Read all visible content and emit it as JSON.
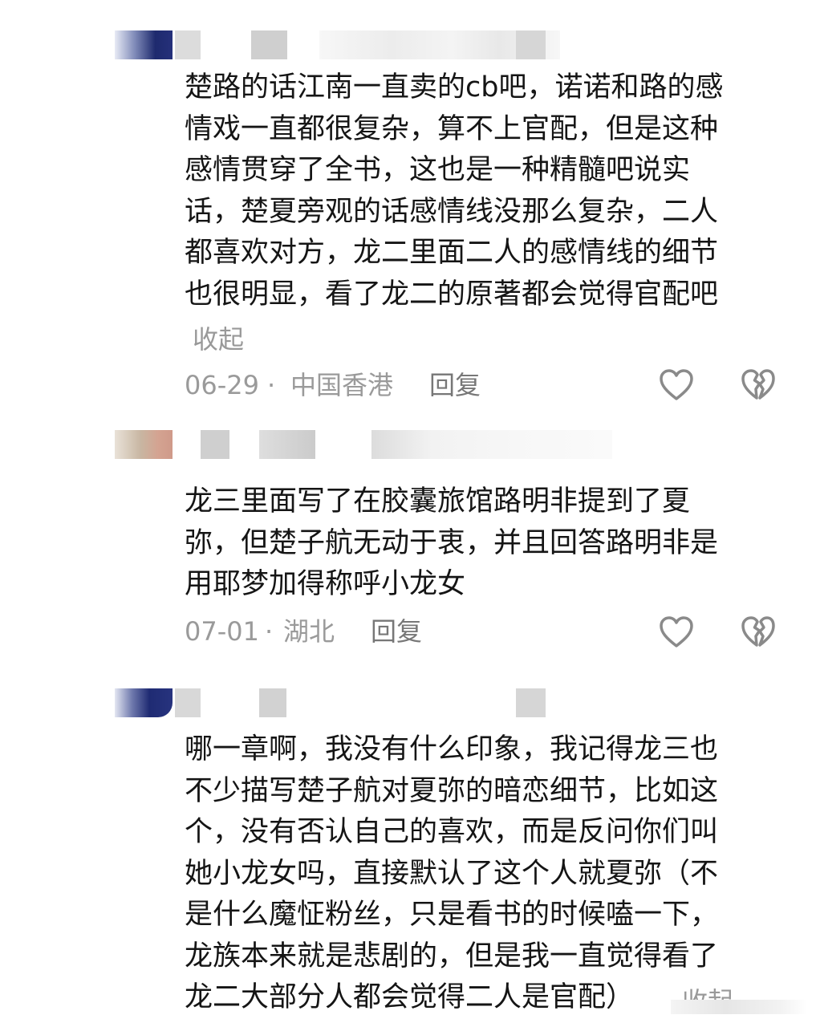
{
  "comments": [
    {
      "username": "",
      "text": "楚路的话江南一直卖的cb吧，诺诺和路的感\n情戏一直都很复杂，算不上官配，但是这种\n感情贯穿了全书，这也是一种精髓吧说实\n话，楚夏旁观的话感情线没那么复杂，二人\n都喜欢对方，龙二里面二人的感情线的细节\n也很明显，看了龙二的原著都会觉得官配吧",
      "collapse": "收起",
      "date": "06-29",
      "separator": "·",
      "location": "中国香港",
      "reply": "回复"
    },
    {
      "username": "",
      "text": "龙三里面写了在胶囊旅馆路明非提到了夏\n弥，但楚子航无动于衷，并且回答路明非是\n用耶梦加得称呼小龙女",
      "date": "07-01",
      "separator": "·",
      "location": "湖北",
      "reply": "回复"
    },
    {
      "username": "",
      "text": "哪一章啊，我没有什么印象，我记得龙三也\n不少描写楚子航对夏弥的暗恋细节，比如这\n个，没有否认自己的喜欢，而是反问你们叫\n她小龙女吗，直接默认了这个人就夏弥（不\n是什么魔怔粉丝，只是看书的时候嗑一下，\n龙族本来就是悲剧的，但是我一直觉得看了\n龙二大部分人都会觉得二人是官配）",
      "collapse": "收起"
    }
  ],
  "icons": {
    "like": "heart-outline-icon",
    "dislike": "broken-heart-icon"
  },
  "colors": {
    "meta_text": "#9a9a9a",
    "icon_stroke": "#8a8a8a"
  }
}
